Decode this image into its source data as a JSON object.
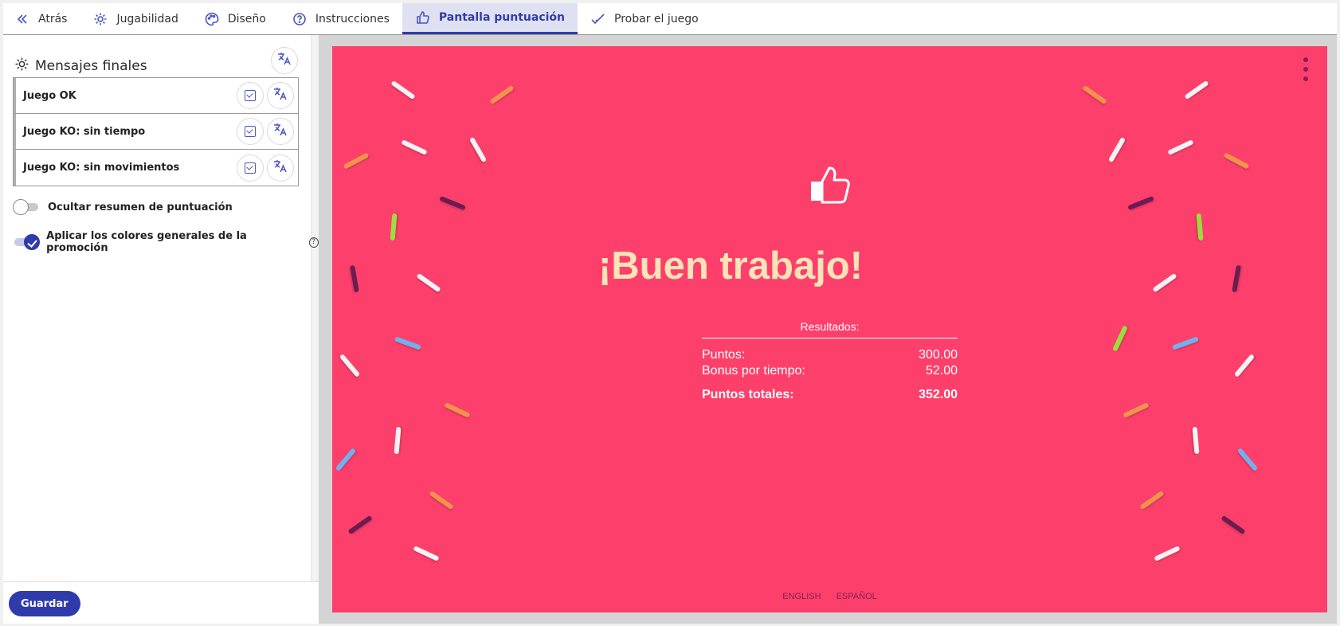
{
  "nav": {
    "back": "Atrás",
    "gameplay": "Jugabilidad",
    "design": "Diseño",
    "instructions": "Instrucciones",
    "score_screen": "Pantalla puntuación",
    "test_game": "Probar el juego"
  },
  "sidebar": {
    "title": "Mensajes finales",
    "messages": [
      {
        "label": "Juego OK"
      },
      {
        "label": "Juego KO: sin tiempo"
      },
      {
        "label": "Juego KO: sin movimientos"
      }
    ],
    "hide_summary_label": "Ocultar resumen de puntuación",
    "hide_summary_on": false,
    "apply_colors_label": "Aplicar los colores generales de la promoción",
    "apply_colors_on": true,
    "help_glyph": "?",
    "save_label": "Guardar"
  },
  "preview": {
    "background_color": "#fd406b",
    "headline": "¡Buen trabajo!",
    "results_title": "Resultados:",
    "rows": [
      {
        "label": "Puntos:",
        "value": "300.00"
      },
      {
        "label": "Bonus por tiempo:",
        "value": "52.00"
      }
    ],
    "total_label": "Puntos totales:",
    "total_value": "352.00",
    "languages": [
      "ENGLISH",
      "ESPAÑOL"
    ]
  }
}
